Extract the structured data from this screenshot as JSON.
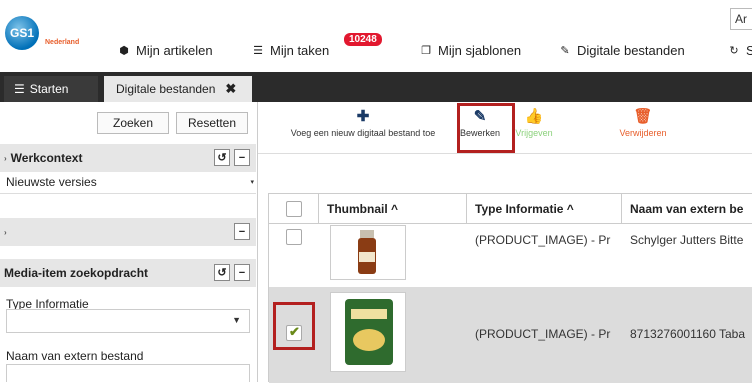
{
  "header": {
    "logo_text": "GS1",
    "logo_sub": "Nederland",
    "nav": [
      {
        "label": "Mijn artikelen",
        "icon": "cube-icon"
      },
      {
        "label": "Mijn taken",
        "icon": "list-icon"
      },
      {
        "label": "Mijn sjablonen",
        "icon": "copy-icon"
      },
      {
        "label": "Digitale bestanden",
        "icon": "paperclip-icon"
      },
      {
        "label": "S",
        "icon": "refresh-icon"
      }
    ],
    "tasks_badge": "10248",
    "lang_text": "Ar"
  },
  "tabs": {
    "start_label": "Starten",
    "active_label": "Digitale bestanden"
  },
  "left_panel": {
    "search_label": "Zoeken",
    "reset_label": "Resetten",
    "werkcontext_title": "Werkcontext",
    "version_value": "Nieuwste versies",
    "media_title": "Media-item zoekopdracht",
    "type_label": "Type Informatie",
    "type_value": "",
    "extern_label": "Naam van extern bestand"
  },
  "toolbar": {
    "add_label": "Voeg een nieuw digitaal bestand toe",
    "edit_label": "Bewerken",
    "approve_label": "Vrijgeven",
    "delete_label": "Verwijderen"
  },
  "grid": {
    "headers": [
      "Thumbnail ^",
      "Type Informatie ^",
      "Naam van extern be"
    ],
    "rows": [
      {
        "type": "(PRODUCT_IMAGE) - Pr",
        "name": "Schylger Jutters Bitte",
        "selected": false
      },
      {
        "type": "(PRODUCT_IMAGE) - Pr",
        "name": "8713276001160 Taba",
        "selected": true
      }
    ]
  },
  "colors": {
    "accent_red": "#b3201f",
    "badge_red": "#e2182f",
    "dark_bar": "#2b2b2b",
    "add_icon": "#1a3a66",
    "approve_icon": "#7cc36b",
    "delete_icon": "#e85e2b"
  }
}
